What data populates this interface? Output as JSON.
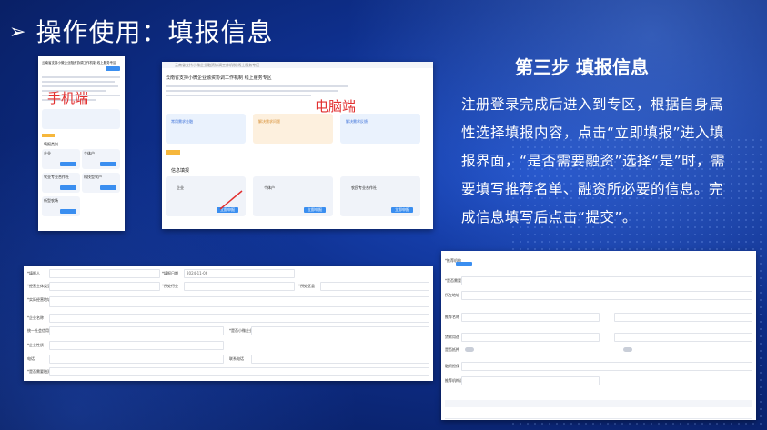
{
  "slide": {
    "title": "操作使用：填报信息",
    "arrow": "➢",
    "step_title": "第三步 填报信息",
    "description": "注册登录完成后进入到专区，根据自身属性选择填报内容，点击“立即填报”进入填报界面，“是否需要融资”选择“是”时，需要填写推荐名单、融资所必要的信息。完成信息填写后点击“提交”。"
  },
  "mobile": {
    "label": "手机端",
    "title": "云南省支持小微企业融资协调工作机制 线上服务专区",
    "section": "填报类别",
    "items": [
      "企业",
      "个体户",
      "农业专业合作社",
      "科技型农户",
      "新型农场"
    ],
    "button": "立即填报"
  },
  "desktop": {
    "label": "电脑端",
    "breadcrumb": "云南省支持小微企业融资协调工作机制 线上服务专区",
    "title": "云南省支持小微企业融资协调工作机制 线上服务专区",
    "cards": [
      "常用需求金融",
      "解决需求问题",
      "解决需求反馈"
    ],
    "section": "信息填报",
    "items": [
      "企业",
      "个体户",
      "农民专业合作社"
    ],
    "button": "立即申报"
  },
  "form_left": {
    "labels": [
      "*填报人",
      "*填报日期",
      "*经营主体类型",
      "*所处行业",
      "*所处区县",
      "*实际经营地址",
      "*企业名称",
      "统一社会信用代码",
      "*是否小微企业",
      "*企业性质",
      "电话",
      "联系电话",
      "*是否需要融资"
    ],
    "date_value": "2024-11-06"
  },
  "form_right": {
    "labels": [
      "*推荐机构",
      "*是否需要融资",
      "所在地址",
      "推荐名称",
      "贷款用途",
      "是否抵押",
      "融资担保",
      "推荐机构选择"
    ]
  }
}
